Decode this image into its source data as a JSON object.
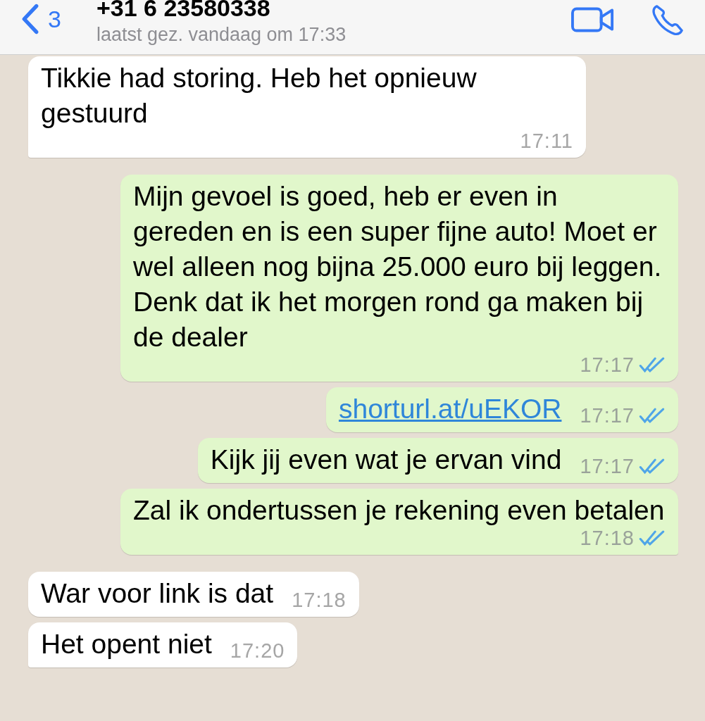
{
  "header": {
    "back_count": "3",
    "title": "+31 6 23580338",
    "subtitle": "laatst gez. vandaag om 17:33"
  },
  "messages": [
    {
      "kind": "incoming",
      "text": "Tikkie had storing. Heb het opnieuw gestuurd",
      "time": "17:11",
      "tail": true,
      "link": false
    },
    {
      "kind": "outgoing",
      "text": "Mijn gevoel is goed, heb er even in gereden en is een super fijne auto! Moet er wel alleen nog bijna 25.000 euro bij leggen. Denk dat ik het morgen rond ga maken bij de dealer",
      "time": "17:17",
      "read": true,
      "tail": false,
      "link": false
    },
    {
      "kind": "outgoing",
      "text": "shorturl.at/uEKOR",
      "link": true,
      "time": "17:17",
      "read": true,
      "tail": false
    },
    {
      "kind": "outgoing",
      "text": "Kijk jij even wat je ervan vind",
      "time": "17:17",
      "read": true,
      "tail": false,
      "link": false
    },
    {
      "kind": "outgoing",
      "text": "Zal ik ondertussen je rekening even betalen",
      "time": "17:18",
      "read": true,
      "tail": true,
      "link": false
    },
    {
      "kind": "incoming",
      "text": "War voor link is dat",
      "time": "17:18",
      "tail": false,
      "link": false
    },
    {
      "kind": "incoming",
      "text": "Het opent niet",
      "time": "17:20",
      "tail": true,
      "link": false
    }
  ]
}
